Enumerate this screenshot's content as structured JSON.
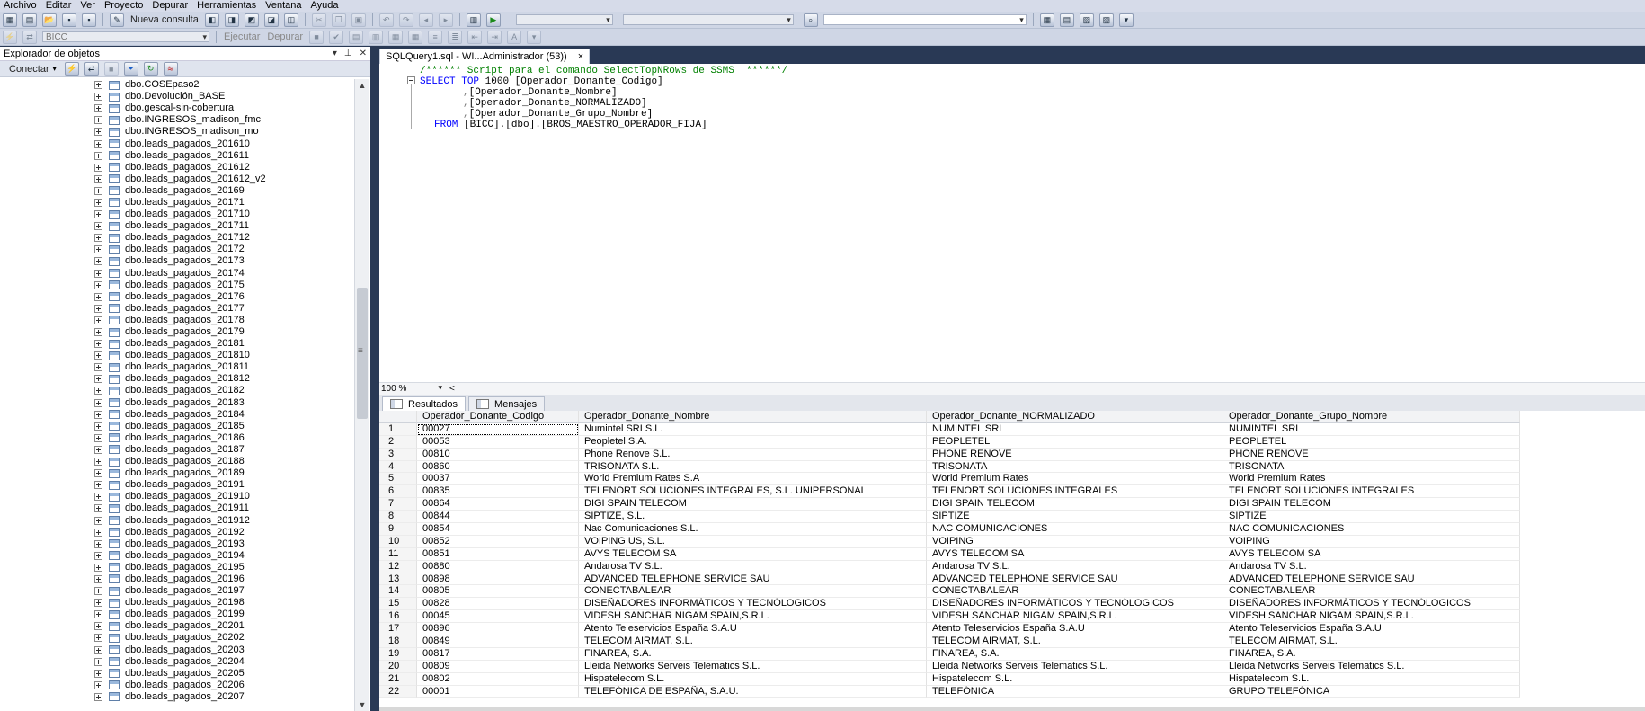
{
  "menu": [
    "Archivo",
    "Editar",
    "Ver",
    "Proyecto",
    "Depurar",
    "Herramientas",
    "Ventana",
    "Ayuda"
  ],
  "toolbar": {
    "new_query": "Nueva consulta",
    "database": "BICC",
    "execute": "Ejecutar",
    "debug": "Depurar"
  },
  "object_explorer": {
    "title": "Explorador de objetos",
    "connect": "Conectar",
    "items": [
      "dbo.COSEpaso2",
      "dbo.Devolución_BASE",
      "dbo.gescal-sin-cobertura",
      "dbo.INGRESOS_madison_fmc",
      "dbo.INGRESOS_madison_mo",
      "dbo.leads_pagados_201610",
      "dbo.leads_pagados_201611",
      "dbo.leads_pagados_201612",
      "dbo.leads_pagados_201612_v2",
      "dbo.leads_pagados_20169",
      "dbo.leads_pagados_20171",
      "dbo.leads_pagados_201710",
      "dbo.leads_pagados_201711",
      "dbo.leads_pagados_201712",
      "dbo.leads_pagados_20172",
      "dbo.leads_pagados_20173",
      "dbo.leads_pagados_20174",
      "dbo.leads_pagados_20175",
      "dbo.leads_pagados_20176",
      "dbo.leads_pagados_20177",
      "dbo.leads_pagados_20178",
      "dbo.leads_pagados_20179",
      "dbo.leads_pagados_20181",
      "dbo.leads_pagados_201810",
      "dbo.leads_pagados_201811",
      "dbo.leads_pagados_201812",
      "dbo.leads_pagados_20182",
      "dbo.leads_pagados_20183",
      "dbo.leads_pagados_20184",
      "dbo.leads_pagados_20185",
      "dbo.leads_pagados_20186",
      "dbo.leads_pagados_20187",
      "dbo.leads_pagados_20188",
      "dbo.leads_pagados_20189",
      "dbo.leads_pagados_20191",
      "dbo.leads_pagados_201910",
      "dbo.leads_pagados_201911",
      "dbo.leads_pagados_201912",
      "dbo.leads_pagados_20192",
      "dbo.leads_pagados_20193",
      "dbo.leads_pagados_20194",
      "dbo.leads_pagados_20195",
      "dbo.leads_pagados_20196",
      "dbo.leads_pagados_20197",
      "dbo.leads_pagados_20198",
      "dbo.leads_pagados_20199",
      "dbo.leads_pagados_20201",
      "dbo.leads_pagados_20202",
      "dbo.leads_pagados_20203",
      "dbo.leads_pagados_20204",
      "dbo.leads_pagados_20205",
      "dbo.leads_pagados_20206",
      "dbo.leads_pagados_20207"
    ]
  },
  "document": {
    "tab_title": "SQLQuery1.sql - WI...Administrador (53))",
    "close": "×",
    "comment": "/****** Script para el comando SelectTopNRows de SSMS  ******/",
    "select_kw": "SELECT",
    "top_kw": "TOP",
    "top_n": "1000",
    "col1": "[Operador_Donante_Codigo]",
    "col2": "[Operador_Donante_Nombre]",
    "col3": "[Operador_Donante_NORMALIZADO]",
    "col4": "[Operador_Donante_Grupo_Nombre]",
    "comma": ",",
    "from_kw": "FROM",
    "from_obj": "[BICC].[dbo].[BROS_MAESTRO_OPERADOR_FIJA]"
  },
  "zoom": "100 %",
  "results": {
    "tabs": [
      "Resultados",
      "Mensajes"
    ],
    "columns": [
      "Operador_Donante_Codigo",
      "Operador_Donante_Nombre",
      "Operador_Donante_NORMALIZADO",
      "Operador_Donante_Grupo_Nombre"
    ],
    "rows": [
      [
        "1",
        "00027",
        "Numintel SRI S.L.",
        "NUMINTEL SRI",
        "NUMINTEL SRI"
      ],
      [
        "2",
        "00053",
        "Peopletel S.A.",
        "PEOPLETEL",
        "PEOPLETEL"
      ],
      [
        "3",
        "00810",
        "Phone Renove S.L.",
        "PHONE RENOVE",
        "PHONE RENOVE"
      ],
      [
        "4",
        "00860",
        "TRISONATA S.L.",
        "TRISONATA",
        "TRISONATA"
      ],
      [
        "5",
        "00037",
        "World Premium Rates S.A",
        "World Premium Rates",
        "World Premium Rates"
      ],
      [
        "6",
        "00835",
        "TELENORT SOLUCIONES INTEGRALES, S.L. UNIPERSONAL",
        "TELENORT SOLUCIONES INTEGRALES",
        "TELENORT SOLUCIONES INTEGRALES"
      ],
      [
        "7",
        "00864",
        "DIGI SPAIN TELECOM",
        "DIGI SPAIN TELECOM",
        "DIGI SPAIN TELECOM"
      ],
      [
        "8",
        "00844",
        "SIPTIZE, S.L.",
        "SIPTIZE",
        "SIPTIZE"
      ],
      [
        "9",
        "00854",
        "Nac Comunicaciones S.L.",
        "NAC COMUNICACIONES",
        "NAC COMUNICACIONES"
      ],
      [
        "10",
        "00852",
        "VOIPING US, S.L.",
        "VOIPING",
        "VOIPING"
      ],
      [
        "11",
        "00851",
        "AVYS TELECOM SA",
        "AVYS TELECOM SA",
        "AVYS TELECOM SA"
      ],
      [
        "12",
        "00880",
        "Andarosa TV S.L.",
        "Andarosa TV S.L.",
        "Andarosa TV S.L."
      ],
      [
        "13",
        "00898",
        "ADVANCED TELEPHONE SERVICE SAU",
        "ADVANCED TELEPHONE SERVICE SAU",
        "ADVANCED TELEPHONE SERVICE SAU"
      ],
      [
        "14",
        "00805",
        "CONECTABALEAR",
        "CONECTABALEAR",
        "CONECTABALEAR"
      ],
      [
        "15",
        "00828",
        "DISEÑADORES INFORMÁTICOS Y TECNÓLOGICOS",
        "DISEÑADORES INFORMÁTICOS Y TECNÓLOGICOS",
        "DISEÑADORES INFORMÁTICOS Y TECNÓLOGICOS"
      ],
      [
        "16",
        "00045",
        "VIDESH SANCHAR NIGAM SPAIN,S.R.L.",
        "VIDESH SANCHAR NIGAM SPAIN,S.R.L.",
        "VIDESH SANCHAR NIGAM SPAIN,S.R.L."
      ],
      [
        "17",
        "00896",
        "Atento Teleservicios España S.A.U",
        "Atento Teleservicios España S.A.U",
        "Atento Teleservicios España S.A.U"
      ],
      [
        "18",
        "00849",
        "TELECOM AIRMAT, S.L.",
        "TELECOM AIRMAT, S.L.",
        "TELECOM AIRMAT, S.L."
      ],
      [
        "19",
        "00817",
        "FINAREA, S.A.",
        "FINAREA, S.A.",
        "FINAREA, S.A."
      ],
      [
        "20",
        "00809",
        "Lleida Networks Serveis Telematics S.L.",
        "Lleida Networks Serveis Telematics S.L.",
        "Lleida Networks Serveis Telematics S.L."
      ],
      [
        "21",
        "00802",
        "Hispatelecom S.L.",
        "Hispatelecom S.L.",
        "Hispatelecom S.L."
      ],
      [
        "22",
        "00001",
        "TELEFÓNICA DE ESPAÑA, S.A.U.",
        "TELEFÓNICA",
        "GRUPO TELEFÓNICA"
      ]
    ]
  }
}
